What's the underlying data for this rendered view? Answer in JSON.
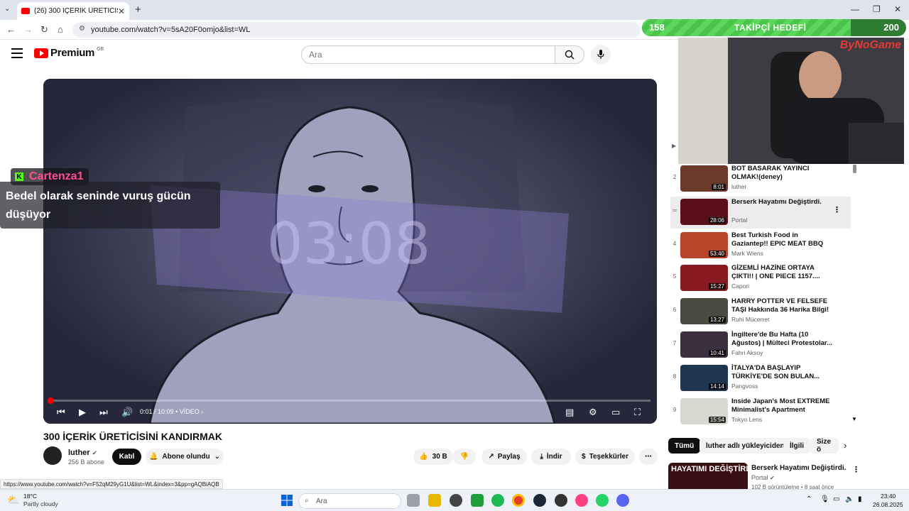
{
  "browser": {
    "tab_title": "(26) 300 İÇERİK ÜRETİCİSİNİ KA",
    "url": "youtube.com/watch?v=5sA20F0omjo&list=WL",
    "status_url": "https://www.youtube.com/watch?v=F52qM29yG1U&list=WL&index=3&pp=gAQBiAQB"
  },
  "overlay": {
    "goal_current": "158",
    "goal_title": "TAKİPÇİ HEDEFİ",
    "goal_target": "200",
    "goal_progress": 0.79,
    "brand": "ByNoGame",
    "chat_user": "Cartenza1",
    "chat_message": "Bedel olarak seninde vuruş gücün düşüyor",
    "kick_icon": "K"
  },
  "header": {
    "logo_text": "Premium",
    "region": "GB",
    "search_placeholder": "Ara"
  },
  "player": {
    "time": "0:01 / 10:09",
    "chapter": "VİDEO",
    "progress": 0.001,
    "watermark": "03:08"
  },
  "video": {
    "title": "300 İÇERİK ÜRETİCİSİNİ KANDIRMAK",
    "channel": "luther",
    "subs": "256 B abone",
    "join": "Katıl",
    "subscribed": "Abone olundu",
    "likes": "30 B",
    "share": "Paylaş",
    "download": "İndir",
    "thanks": "Teşekkürler"
  },
  "playlist": [
    {
      "num": "2",
      "title": "BOT BASARAK YAYINCI OLMAK!(deney)",
      "channel": "luther",
      "duration": "8:01",
      "color": "#6b3a2a"
    },
    {
      "num": "",
      "title": "Berserk Hayatımı Değiştirdi.",
      "channel": "Portal",
      "duration": "28:06",
      "color": "#5a1018",
      "current": true
    },
    {
      "num": "4",
      "title": "Best Turkish Food in Gaziantep!! EPIC MEAT BBQ +...",
      "channel": "Mark Wiens",
      "duration": "53:40",
      "color": "#b8452a"
    },
    {
      "num": "5",
      "title": "GİZEMLİ HAZİNE ORTAYA ÇIKTI!! | ONE PIECE 1157....",
      "channel": "Capori",
      "duration": "15:27",
      "color": "#8a1a22"
    },
    {
      "num": "6",
      "title": "HARRY POTTER VE FELSEFE TAŞI Hakkında 36 Harika Bilgi!",
      "channel": "Ruhi Mücerret",
      "duration": "13:27",
      "color": "#4a4a40"
    },
    {
      "num": "7",
      "title": "İngiltere'de Bu Hafta (10 Ağustos) | Mülteci Protestolar...",
      "channel": "Fahri Aksoy",
      "duration": "10:41",
      "color": "#3a3040"
    },
    {
      "num": "8",
      "title": "İTALYA'DA BAŞLAYIP TÜRKİYE'DE SON BULAN...",
      "channel": "Pangvoss",
      "duration": "14:14",
      "color": "#1f3550"
    },
    {
      "num": "9",
      "title": "Inside Japan's Most EXTREME Minimalist's Apartment",
      "channel": "Tokyo Lens",
      "duration": "15:54",
      "color": "#d8d8d0"
    }
  ],
  "chips": [
    "Tümü",
    "luther adlı yükleyiciden",
    "İlgili",
    "Size ö"
  ],
  "recommended": {
    "title": "Berserk Hayatımı Değiştirdi.",
    "channel": "Portal",
    "meta": "102 B görüntüleme • 8 saat önce",
    "thumb_text": "HAYATIMI DEĞİŞTİRDİ"
  },
  "taskbar": {
    "temp": "18°C",
    "weather": "Partly cloudy",
    "search": "Ara",
    "time": "23:40",
    "date": "26.08.2025"
  }
}
